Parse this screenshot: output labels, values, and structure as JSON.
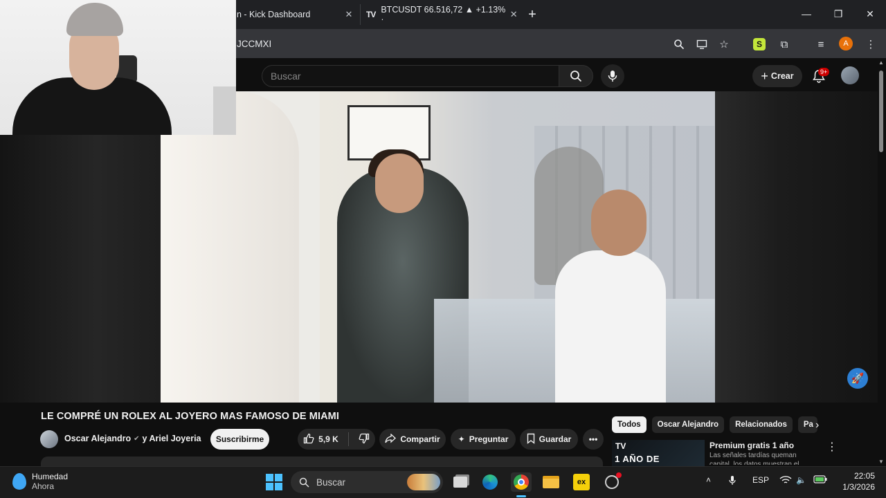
{
  "browser": {
    "tabs": [
      {
        "label": "n - Kick Dashboard"
      },
      {
        "label": "BTCUSDT 66.516,72 ▲ +1.13% ·",
        "icon_text": "TV"
      }
    ],
    "address_fragment": "JCCMXI"
  },
  "youtube": {
    "search_placeholder": "Buscar",
    "create_label": "Crear",
    "notif_badge": "9+"
  },
  "video": {
    "title": "LE COMPRÉ UN ROLEX AL JOYERO MAS FAMOSO DE MIAMI",
    "channel": "Oscar Alejandro",
    "channel_collab": "y Ariel Joyeria",
    "subscribe_label": "Suscribirme",
    "likes": "5,9 K",
    "share_label": "Compartir",
    "ask_label": "Preguntar",
    "save_label": "Guardar"
  },
  "chips": [
    "Todos",
    "Oscar Alejandro",
    "Relacionados",
    "Pa"
  ],
  "ad": {
    "thumb_logo": "TV",
    "thumb_text": "1 AÑO DE",
    "title": "Premium gratis 1 año",
    "desc": "Las señales tardías queman capital, los datos muestran el movimiento"
  },
  "taskbar": {
    "weather_title": "Humedad",
    "weather_sub": "Ahora",
    "search_label": "Buscar",
    "language": "ESP",
    "time": "22:05",
    "date": "1/3/2026"
  },
  "colors": {
    "youtube_bg": "#0f0f0f",
    "accent_blue": "#4cc2ff",
    "badge_red": "#cc0000",
    "subscribe_bg": "#f1f1f1"
  }
}
